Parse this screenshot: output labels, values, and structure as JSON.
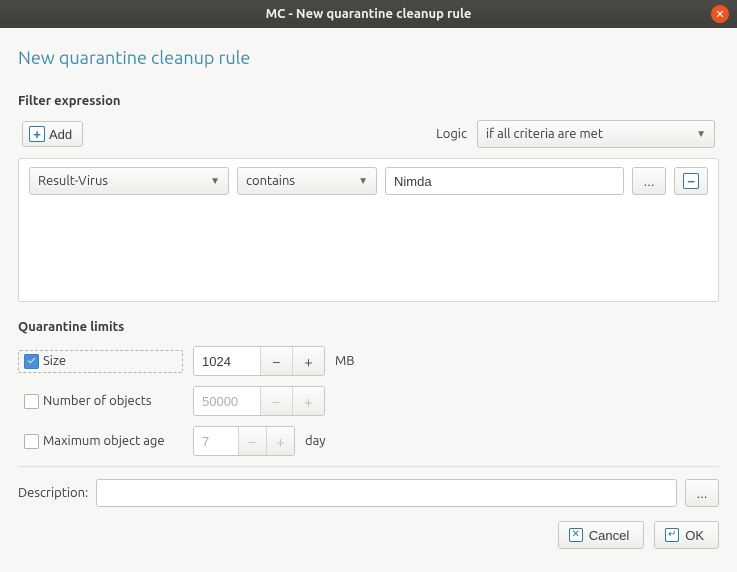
{
  "window": {
    "title": "MC - New quarantine cleanup rule"
  },
  "page": {
    "heading": "New quarantine cleanup rule"
  },
  "filter": {
    "section_label": "Filter expression",
    "add_label": "Add",
    "logic_label": "Logic",
    "logic_value": "if all criteria are met",
    "criteria": [
      {
        "field": "Result-Virus",
        "operator": "contains",
        "value": "Nimda",
        "browse_label": "..."
      }
    ]
  },
  "limits": {
    "section_label": "Quarantine limits",
    "size": {
      "label": "Size",
      "checked": true,
      "value": "1024",
      "unit": "MB"
    },
    "count": {
      "label": "Number of objects",
      "checked": false,
      "value": "50000"
    },
    "age": {
      "label": "Maximum object age",
      "checked": false,
      "value": "7",
      "unit": "day"
    }
  },
  "description": {
    "label": "Description:",
    "value": "",
    "browse_label": "..."
  },
  "buttons": {
    "cancel": "Cancel",
    "ok": "OK"
  }
}
